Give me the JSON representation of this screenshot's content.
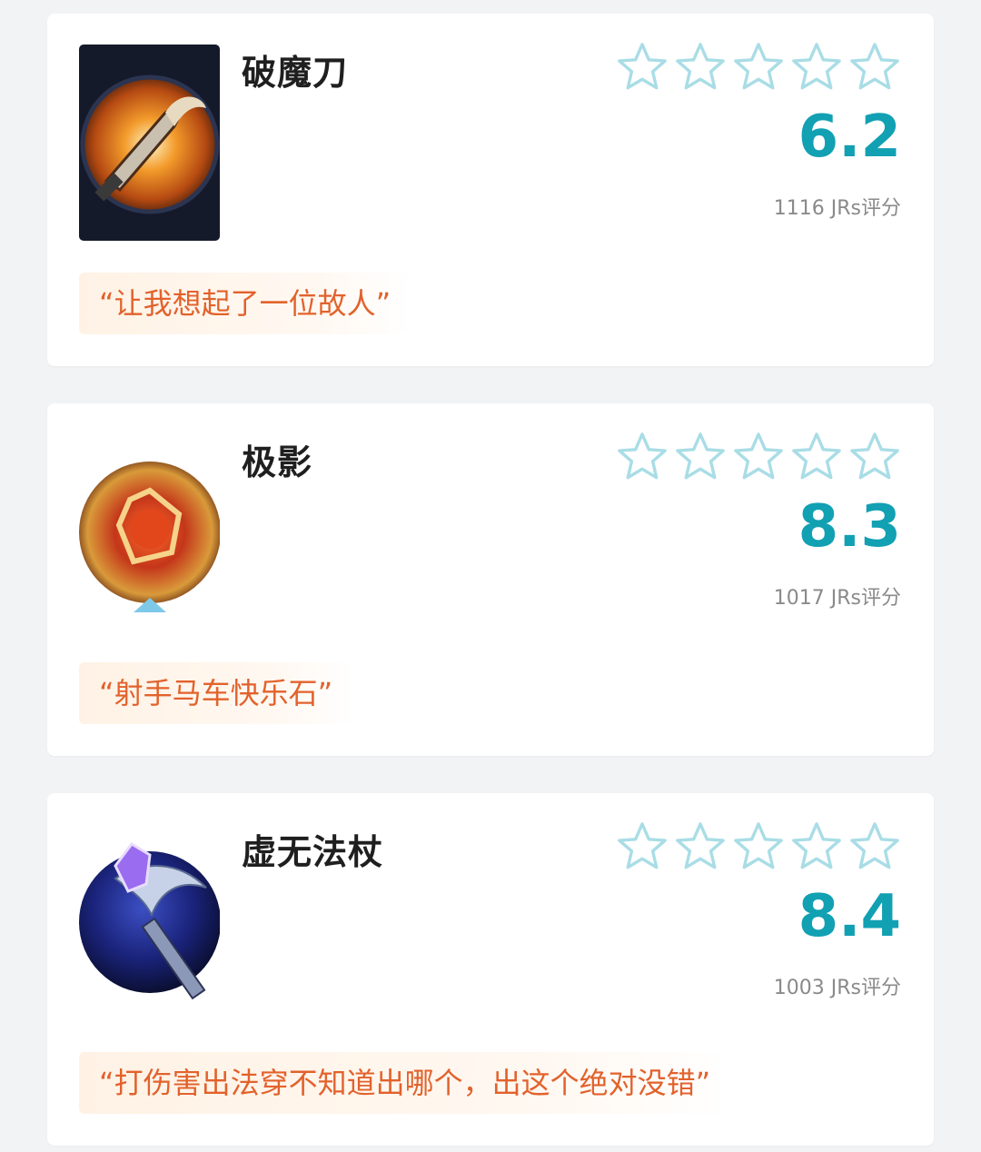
{
  "items": [
    {
      "name": "破魔刀",
      "score": "6.2",
      "count": "1116 JRs评分",
      "quote": "“让我想起了一位故人”",
      "icon": "broadsword-item-icon",
      "stars_filled": 0
    },
    {
      "name": "极影",
      "score": "8.3",
      "count": "1017 JRs评分",
      "quote": "“射手马车快乐石”",
      "icon": "shadow-orb-item-icon",
      "stars_filled": 0
    },
    {
      "name": "虚无法杖",
      "score": "8.4",
      "count": "1003 JRs评分",
      "quote": "“打伤害出法穿不知道出哪个，出这个绝对没错”",
      "icon": "void-staff-item-icon",
      "stars_filled": 0
    }
  ],
  "colors": {
    "score": "#12a0b3",
    "star_outline": "#a9dde6",
    "quote_text": "#e2622c",
    "quote_bg": "#fff2e5"
  }
}
